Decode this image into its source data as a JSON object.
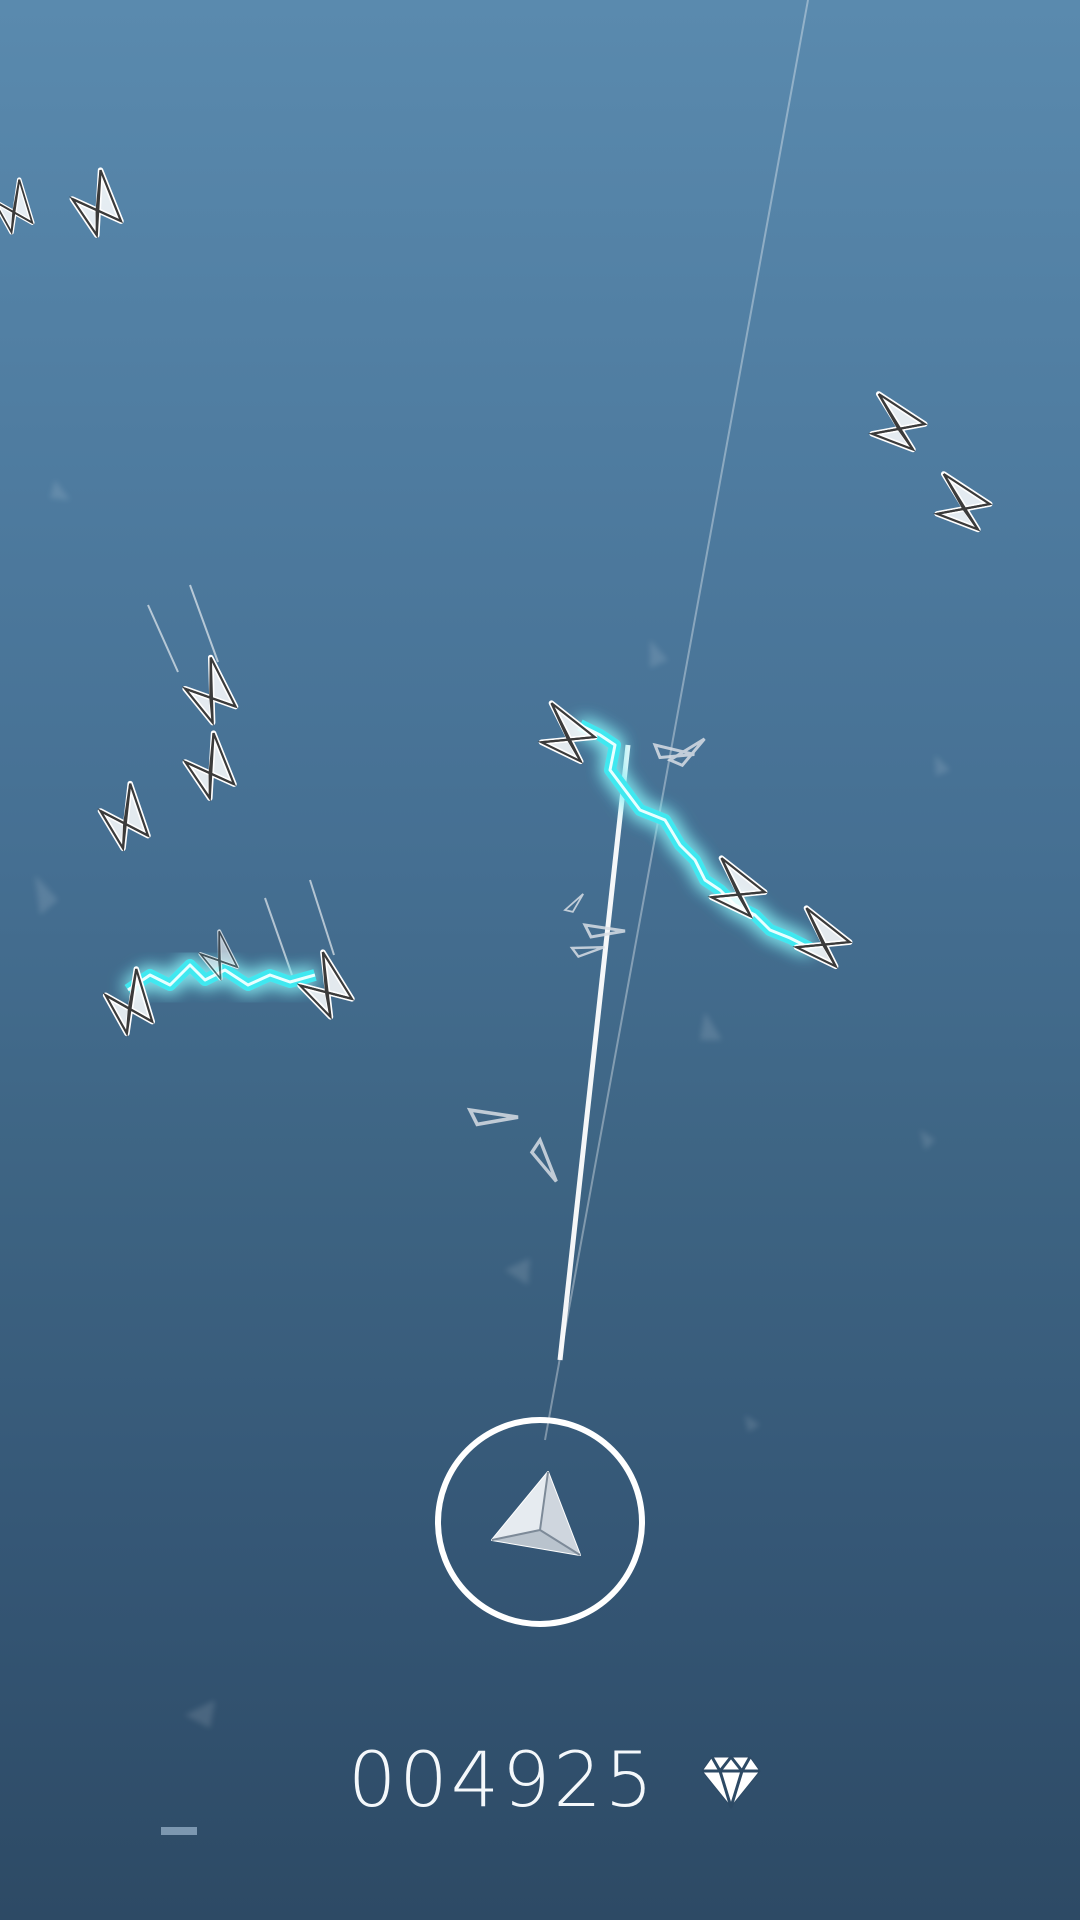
{
  "score": "004925",
  "icons": {
    "currency": "diamond-icon",
    "player": "player-ship-icon",
    "enemy": "enemy-dart-icon"
  },
  "colors": {
    "lightning": "#3fe8f0",
    "lightning_core": "#e8ffff",
    "enemy_stroke": "#ffffff",
    "enemy_inner": "#3b3b3b",
    "text": "#f4f8fb"
  }
}
